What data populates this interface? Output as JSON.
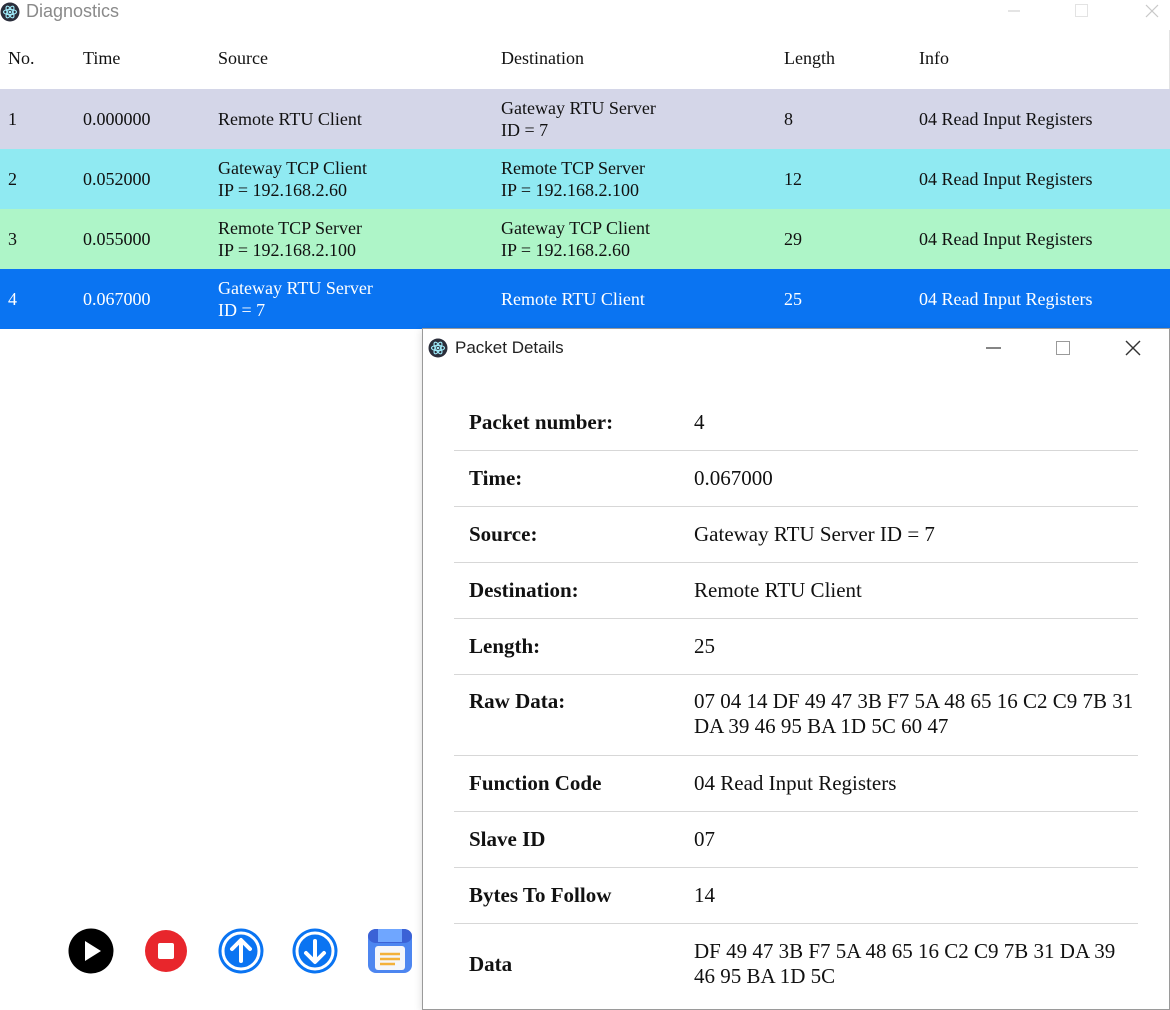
{
  "window": {
    "title": "Diagnostics"
  },
  "table": {
    "headers": {
      "no": "No.",
      "time": "Time",
      "source": "Source",
      "destination": "Destination",
      "length": "Length",
      "info": "Info"
    },
    "rows": [
      {
        "no": "1",
        "time": "0.000000",
        "source_line1": "Remote RTU Client",
        "source_line2": "",
        "dest_line1": "Gateway RTU Server",
        "dest_line2": "ID = 7",
        "length": "8",
        "info": "04 Read Input Registers",
        "color": "#d4d6e8"
      },
      {
        "no": "2",
        "time": "0.052000",
        "source_line1": "Gateway TCP Client",
        "source_line2": "IP = 192.168.2.60",
        "dest_line1": "Remote TCP Server",
        "dest_line2": "IP = 192.168.2.100",
        "length": "12",
        "info": "04 Read Input Registers",
        "color": "#90eaf2"
      },
      {
        "no": "3",
        "time": "0.055000",
        "source_line1": "Remote TCP Server",
        "source_line2": "IP = 192.168.2.100",
        "dest_line1": "Gateway TCP Client",
        "dest_line2": "IP = 192.168.2.60",
        "length": "29",
        "info": "04 Read Input Registers",
        "color": "#aef5c8"
      },
      {
        "no": "4",
        "time": "0.067000",
        "source_line1": "Gateway RTU Server",
        "source_line2": "ID = 7",
        "dest_line1": "Remote RTU Client",
        "dest_line2": "",
        "length": "25",
        "info": "04 Read Input Registers",
        "color": "#0a74f2"
      }
    ]
  },
  "toolbar": {
    "icons": [
      "play-icon",
      "stop-icon",
      "upload-icon",
      "download-icon",
      "save-icon"
    ],
    "colors": {
      "play": "#000000",
      "stop": "#e8262c",
      "arrows": "#0a74f2"
    }
  },
  "dialog": {
    "title": "Packet Details",
    "rows": [
      {
        "key": "Packet number:",
        "value": "4"
      },
      {
        "key": "Time:",
        "value": "0.067000"
      },
      {
        "key": "Source:",
        "value": "Gateway RTU Server ID = 7"
      },
      {
        "key": "Destination:",
        "value": "Remote RTU Client"
      },
      {
        "key": "Length:",
        "value": "25"
      },
      {
        "key": "Raw Data:",
        "value": "07 04 14 DF 49 47 3B F7 5A 48 65 16 C2 C9 7B 31 DA 39 46 95 BA 1D 5C 60 47"
      },
      {
        "key": "Function Code",
        "value": "04 Read Input Registers"
      },
      {
        "key": "Slave ID",
        "value": "07"
      },
      {
        "key": "Bytes To Follow",
        "value": "14"
      },
      {
        "key": "Data",
        "value": "DF 49 47 3B F7 5A 48 65 16 C2 C9 7B 31 DA 39 46 95 BA 1D 5C"
      }
    ]
  }
}
